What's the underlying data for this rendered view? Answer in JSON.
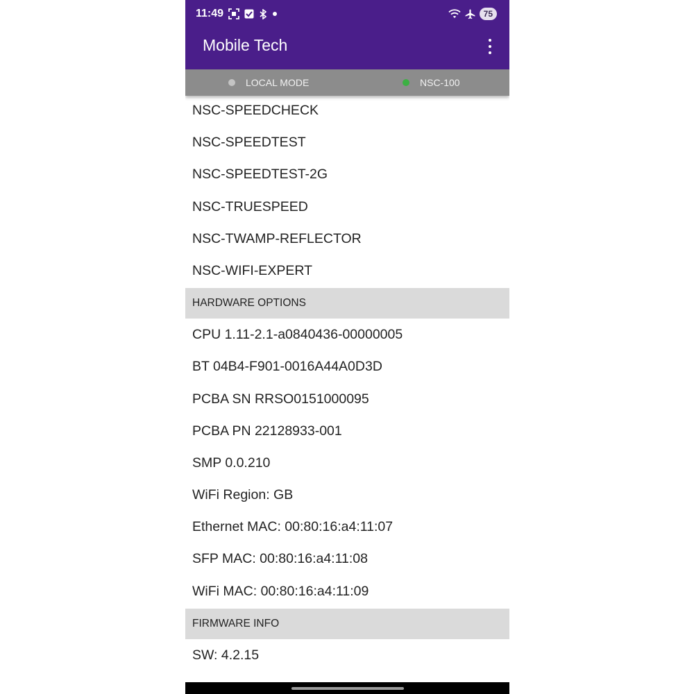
{
  "status_bar": {
    "time": "11:49",
    "battery": "75",
    "left_icons": [
      "screenshot-icon",
      "checkbox-icon",
      "bluetooth-icon",
      "notification-dot-icon"
    ],
    "right_icons": [
      "wifi-icon",
      "airplane-icon"
    ]
  },
  "app_bar": {
    "title": "Mobile Tech",
    "menu_icon": "more-vert-icon"
  },
  "mode_bar": {
    "local_label": "LOCAL MODE",
    "local_dot_color": "#c4c4c4",
    "device_label": "NSC-100",
    "device_dot_color": "#3cb043"
  },
  "software_options": [
    "NSC-SPEEDCHECK",
    "NSC-SPEEDTEST",
    "NSC-SPEEDTEST-2G",
    "NSC-TRUESPEED",
    "NSC-TWAMP-REFLECTOR",
    "NSC-WIFI-EXPERT"
  ],
  "hardware_section": {
    "title": "HARDWARE OPTIONS",
    "items": [
      "CPU 1.11-2.1-a0840436-00000005",
      "BT 04B4-F901-0016A44A0D3D",
      "PCBA SN RRSO0151000095",
      "PCBA PN 22128933-001",
      "SMP 0.0.210",
      "WiFi Region: GB",
      "Ethernet MAC: 00:80:16:a4:11:07",
      "SFP MAC: 00:80:16:a4:11:08",
      "WiFi MAC: 00:80:16:a4:11:09"
    ]
  },
  "firmware_section": {
    "title": "FIRMWARE INFO",
    "items": [
      "SW: 4.2.15"
    ]
  },
  "colors": {
    "primary": "#4a1e8a",
    "mode_bar": "#8c8c8c",
    "section_header": "#dadada"
  }
}
